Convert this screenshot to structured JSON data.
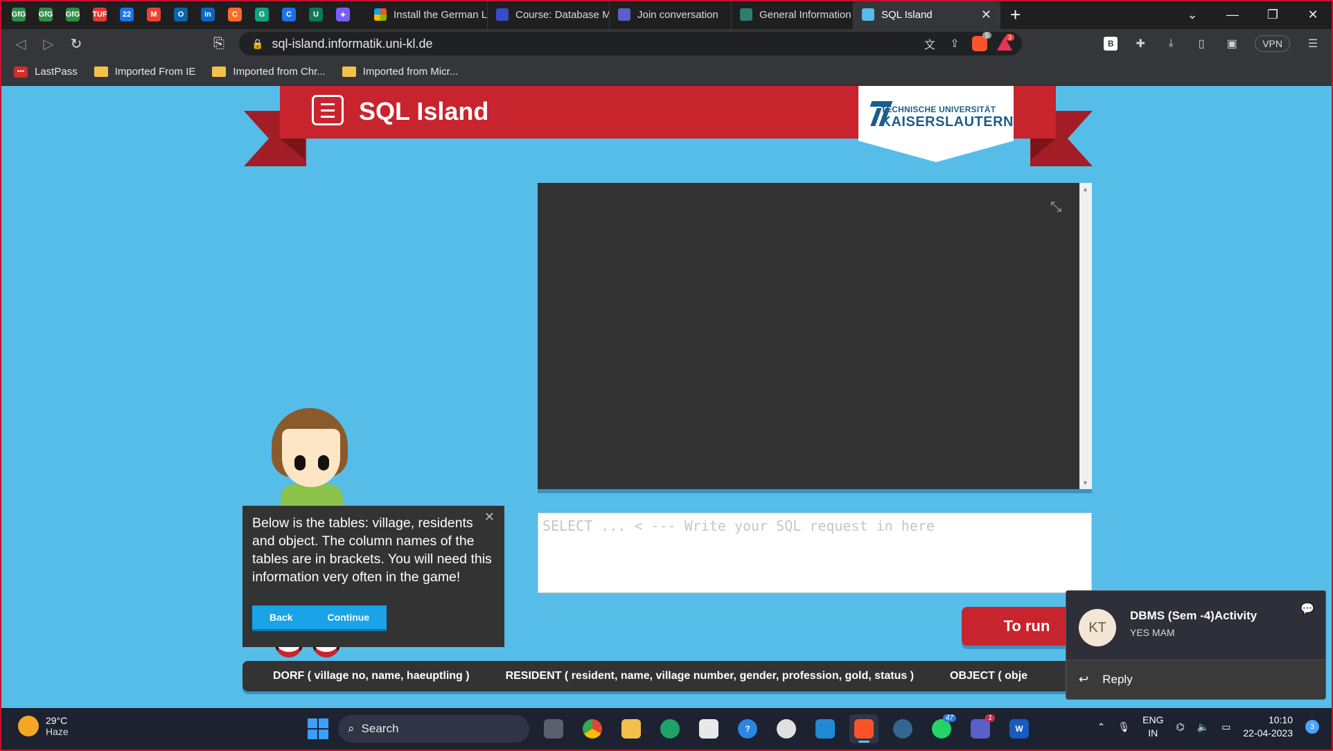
{
  "browser": {
    "tabs": [
      {
        "title": "Install the German Langu",
        "fav_color": "#f25022"
      },
      {
        "title": "Course: Database Manage",
        "fav_color": "#3b4ac9"
      },
      {
        "title": "Join conversation",
        "fav_color": "#5b5fc7"
      },
      {
        "title": "General Information",
        "fav_color": "#2f7d6d"
      },
      {
        "title": "SQL Island",
        "fav_color": "#56bde9",
        "active": true
      }
    ],
    "pinned": [
      {
        "label": "GfG",
        "color": "#2f8d46"
      },
      {
        "label": "GfG",
        "color": "#2f8d46"
      },
      {
        "label": "GfG",
        "color": "#2f8d46"
      },
      {
        "label": "TUF",
        "color": "#e53935"
      },
      {
        "label": "22",
        "color": "#1a73e8"
      },
      {
        "label": "M",
        "color": "#ea4335"
      },
      {
        "label": "O",
        "color": "#0a64ad"
      },
      {
        "label": "in",
        "color": "#0a66c2"
      },
      {
        "label": "C",
        "color": "#ff6b2b"
      },
      {
        "label": "G",
        "color": "#10a37f"
      },
      {
        "label": "C",
        "color": "#1a73e8"
      },
      {
        "label": "U",
        "color": "#0e7a55"
      },
      {
        "label": "✦",
        "color": "#7c5cff"
      }
    ],
    "close_tab": "✕",
    "new_tab": "+",
    "url": "sql-island.informatik.uni-kl.de",
    "brave_shield_count": "5",
    "rewards_count": "3",
    "vpn_label": "VPN",
    "bookmarks": [
      {
        "label": "LastPass",
        "type": "lastpass"
      },
      {
        "label": "Imported From IE",
        "type": "folder"
      },
      {
        "label": "Imported from Chr...",
        "type": "folder"
      },
      {
        "label": "Imported from Micr...",
        "type": "folder"
      }
    ]
  },
  "game": {
    "title": "SQL Island",
    "university_line1": "TECHNISCHE UNIVERSITÄT",
    "university_line2": "KAISERSLAUTERN",
    "sql_placeholder": "SELECT ... < --- Write your SQL request in here",
    "run_button": "To run",
    "dialog_text": "Below is the tables: village, residents and object. The column names of the tables are in brackets. You will need this information very often in the game!",
    "dialog_back": "Back",
    "dialog_continue": "Continue",
    "table_dorf": "DORF ( village no, name, haeuptling )",
    "table_resident": "RESIDENT ( resident, name, village number, gender, profession, gold, status )",
    "table_object": "OBJECT ( obje"
  },
  "notification": {
    "initials": "KT",
    "title": "DBMS (Sem -4)Activity",
    "message": "YES MAM",
    "reply": "Reply"
  },
  "taskbar": {
    "temperature": "29°C",
    "weather": "Haze",
    "search_label": "Search",
    "whatsapp_badge": "47",
    "teams_badge": "1",
    "lang_line1": "ENG",
    "lang_line2": "IN",
    "time": "10:10",
    "date": "22-04-2023",
    "notification_count": "3"
  }
}
